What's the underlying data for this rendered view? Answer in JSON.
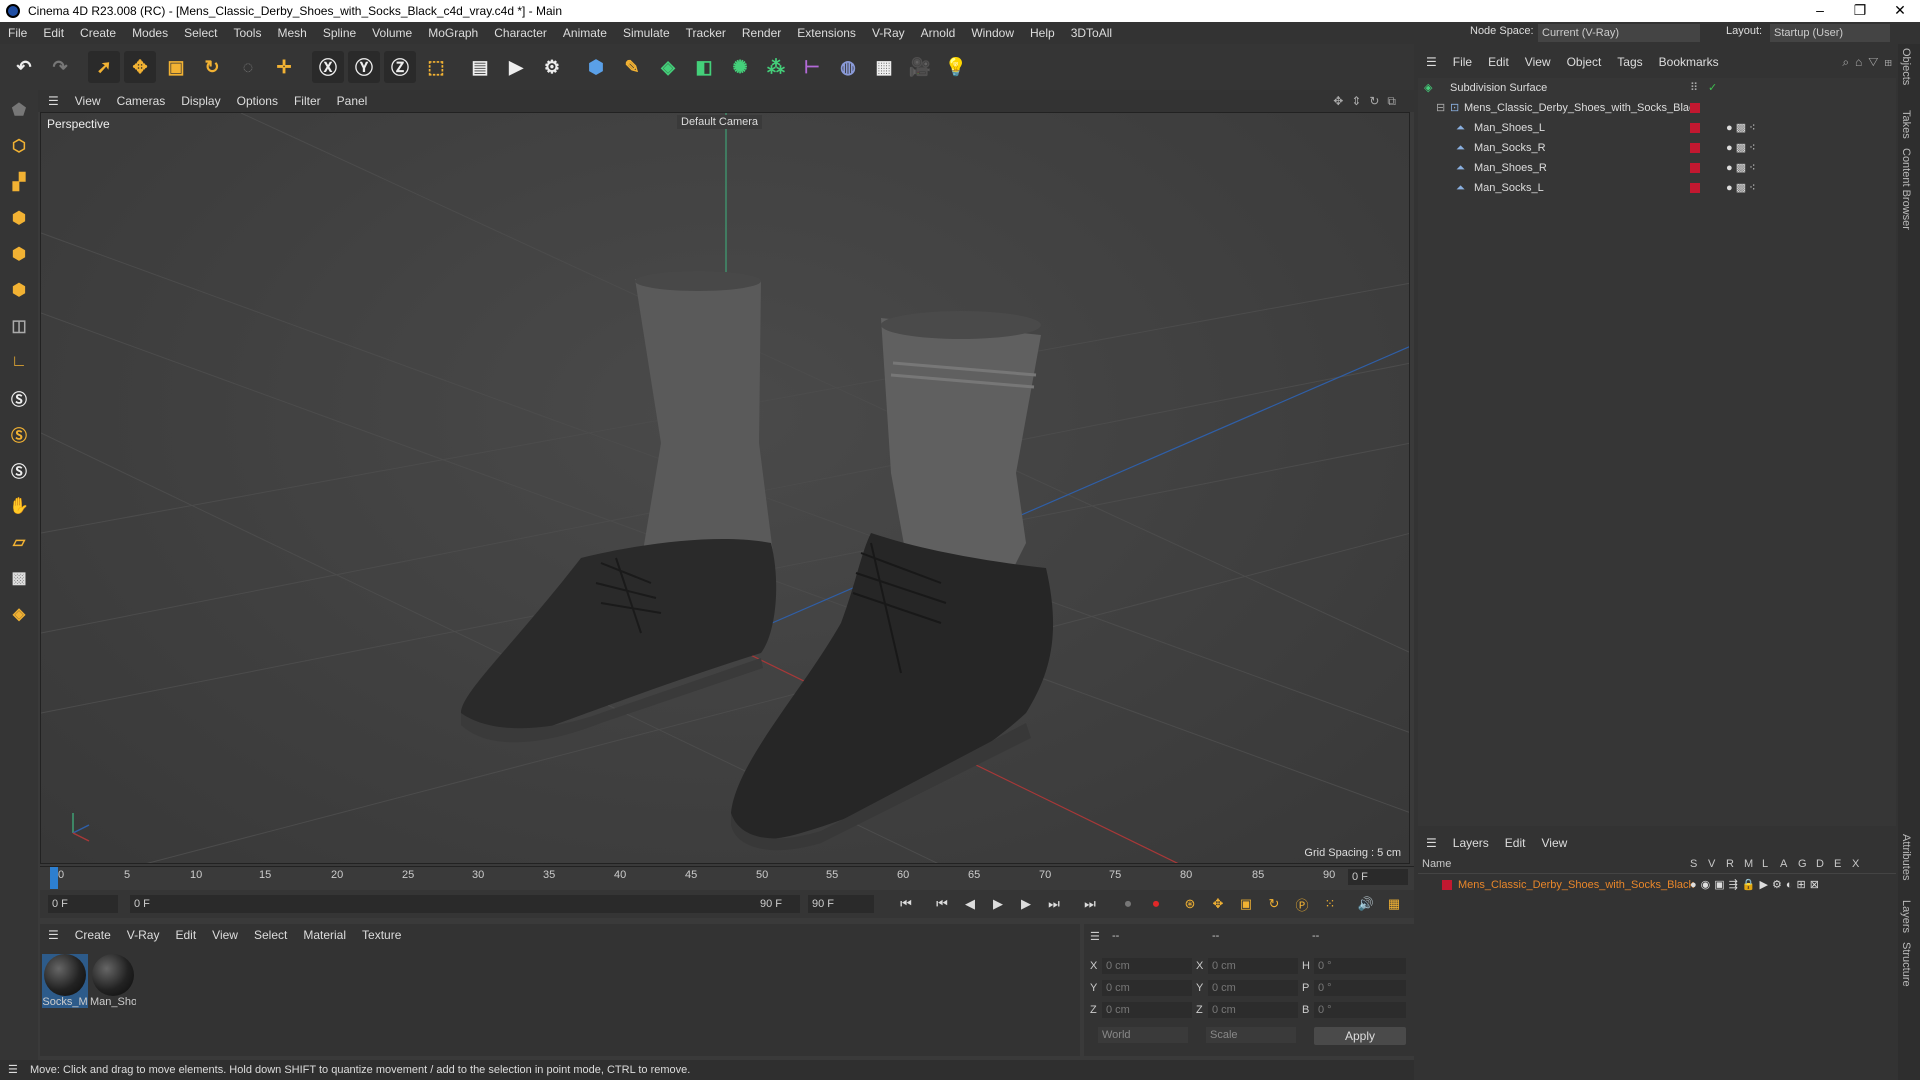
{
  "window": {
    "title": "Cinema 4D R23.008 (RC) - [Mens_Classic_Derby_Shoes_with_Socks_Black_c4d_vray.c4d *] - Main",
    "minimize": "–",
    "maximize": "❐",
    "close": "✕"
  },
  "menubar": {
    "items": [
      "File",
      "Edit",
      "Create",
      "Modes",
      "Select",
      "Tools",
      "Mesh",
      "Spline",
      "Volume",
      "MoGraph",
      "Character",
      "Animate",
      "Simulate",
      "Tracker",
      "Render",
      "Extensions",
      "V-Ray",
      "Arnold",
      "Window",
      "Help",
      "3DToAll"
    ]
  },
  "nodespace": {
    "label": "Node Space:",
    "value": "Current (V-Ray)",
    "layout_label": "Layout:",
    "layout_value": "Startup (User)"
  },
  "viewport": {
    "menu": [
      "View",
      "Cameras",
      "Display",
      "Options",
      "Filter",
      "Panel"
    ],
    "name": "Perspective",
    "camera": "Default Camera",
    "grid_spacing": "Grid Spacing : 5 cm"
  },
  "timeline": {
    "ticks": [
      "0",
      "5",
      "10",
      "15",
      "20",
      "25",
      "30",
      "35",
      "40",
      "45",
      "50",
      "55",
      "60",
      "65",
      "70",
      "75",
      "80",
      "85",
      "90"
    ],
    "frame_end": "0 F"
  },
  "playbar": {
    "start": "0 F",
    "current": "0 F",
    "end": "90 F",
    "end2": "90 F"
  },
  "materials": {
    "menu": [
      "Create",
      "V-Ray",
      "Edit",
      "View",
      "Select",
      "Material",
      "Texture"
    ],
    "items": [
      "Socks_M",
      "Man_Sho"
    ]
  },
  "coords": {
    "head": [
      "--",
      "--",
      "--"
    ],
    "rows": [
      {
        "a": "X",
        "av": "0 cm",
        "b": "X",
        "bv": "0 cm",
        "c": "H",
        "cv": "0 °"
      },
      {
        "a": "Y",
        "av": "0 cm",
        "b": "Y",
        "bv": "0 cm",
        "c": "P",
        "cv": "0 °"
      },
      {
        "a": "Z",
        "av": "0 cm",
        "b": "Z",
        "bv": "0 cm",
        "c": "B",
        "cv": "0 °"
      }
    ],
    "world": "World",
    "scale": "Scale",
    "apply": "Apply"
  },
  "status": "Move: Click and drag to move elements. Hold down SHIFT to quantize movement / add to the selection in point mode, CTRL to remove.",
  "objects": {
    "menu": [
      "File",
      "Edit",
      "View",
      "Object",
      "Tags",
      "Bookmarks"
    ],
    "items": [
      "Subdivision Surface",
      "Mens_Classic_Derby_Shoes_with_Socks_Black",
      "Man_Shoes_L",
      "Man_Socks_R",
      "Man_Shoes_R",
      "Man_Socks_L"
    ]
  },
  "layers": {
    "menu": [
      "Layers",
      "Edit",
      "View"
    ],
    "name_col": "Name",
    "cols": [
      "S",
      "V",
      "R",
      "M",
      "L",
      "A",
      "G",
      "D",
      "E",
      "X"
    ],
    "item": "Mens_Classic_Derby_Shoes_with_Socks_Black"
  },
  "sidetabs": [
    "Objects",
    "Takes",
    "Content Browser",
    "Attributes",
    "Layers",
    "Structure"
  ]
}
